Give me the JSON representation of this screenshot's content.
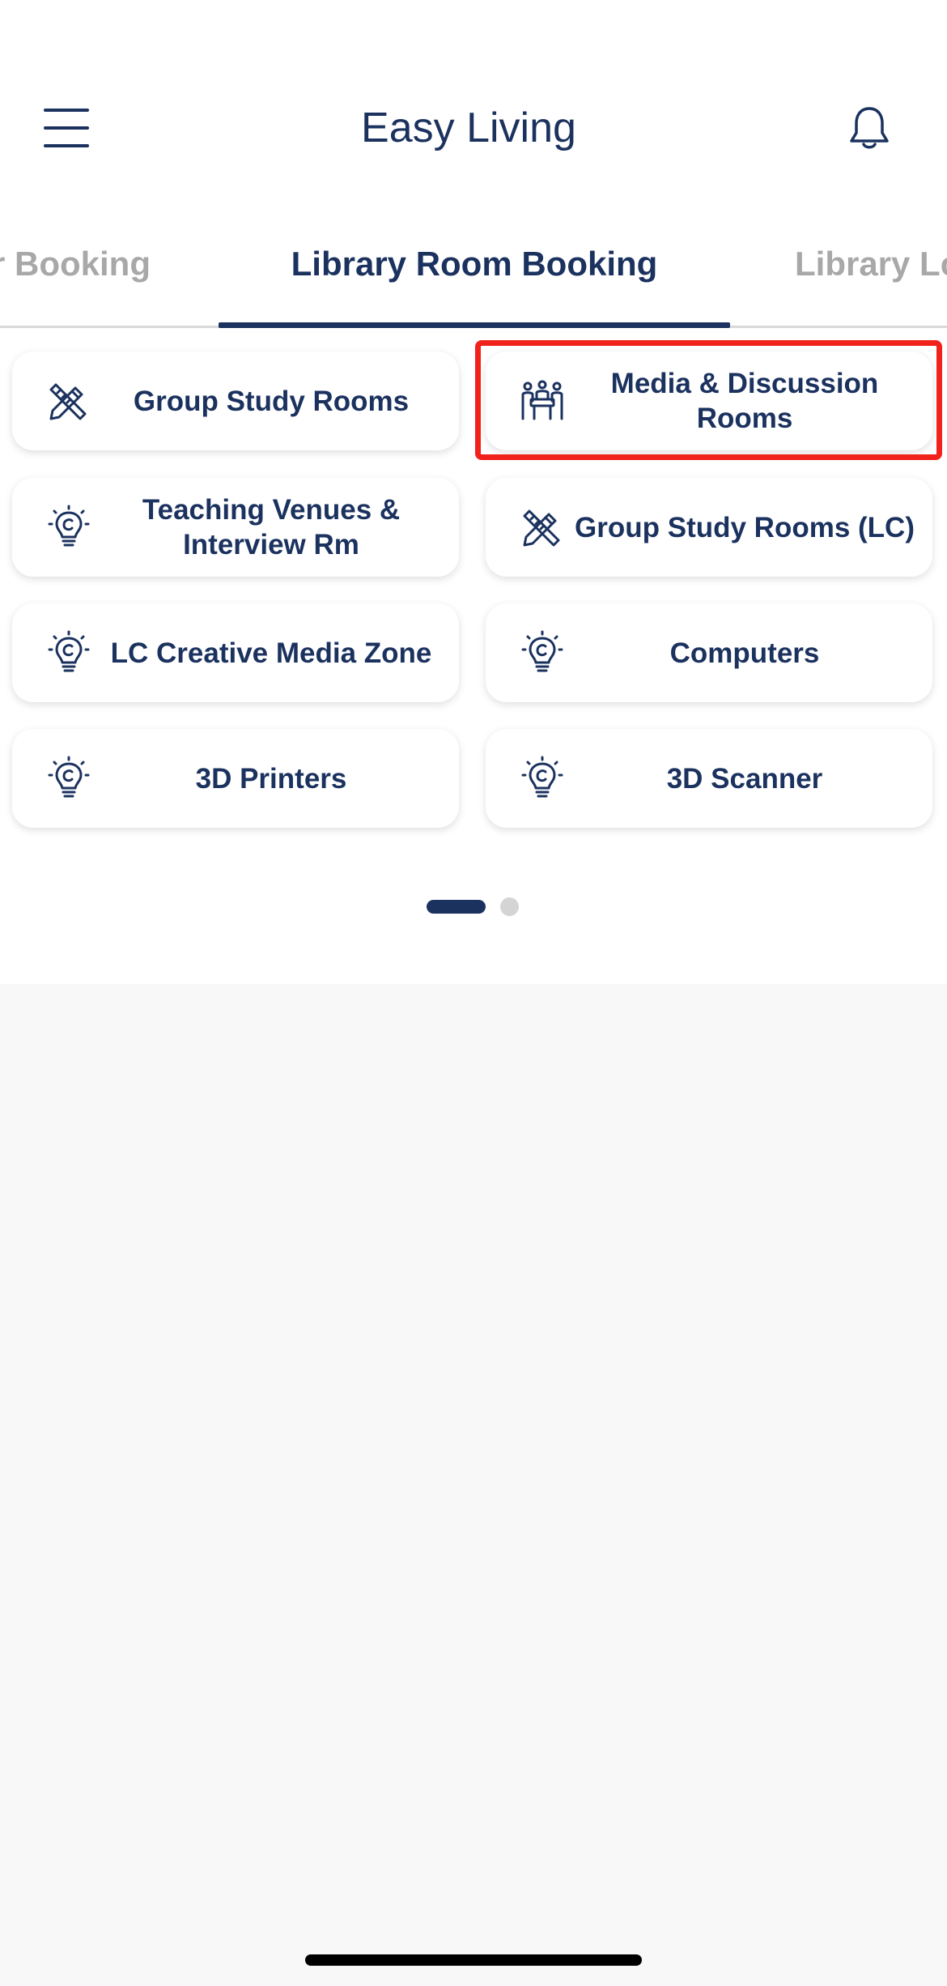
{
  "header": {
    "title": "Easy Living",
    "menu_icon": "hamburger-menu-icon",
    "bell_icon": "bell-icon"
  },
  "tabs": [
    {
      "label": "r Booking",
      "active": false
    },
    {
      "label": "Library Room Booking",
      "active": true
    },
    {
      "label": "Library Lo",
      "active": false
    }
  ],
  "tiles": [
    {
      "label": "Group Study Rooms",
      "icon": "pencil-ruler-icon"
    },
    {
      "label": "Media & Discussion Rooms",
      "icon": "meeting-group-icon",
      "highlighted": true
    },
    {
      "label": "Teaching Venues & Interview Rm",
      "icon": "lightbulb-icon"
    },
    {
      "label": "Group Study Rooms (LC)",
      "icon": "pencil-ruler-icon"
    },
    {
      "label": "LC Creative Media Zone",
      "icon": "lightbulb-icon"
    },
    {
      "label": "Computers",
      "icon": "lightbulb-icon"
    },
    {
      "label": "3D Printers",
      "icon": "lightbulb-icon"
    },
    {
      "label": "3D Scanner",
      "icon": "lightbulb-icon"
    }
  ],
  "pager": {
    "pages": 2,
    "current": 1
  },
  "colors": {
    "primary": "#1b325f",
    "inactive_tab": "#a8a8a8",
    "highlight": "#f0221b",
    "background": "#f8f8f8"
  }
}
